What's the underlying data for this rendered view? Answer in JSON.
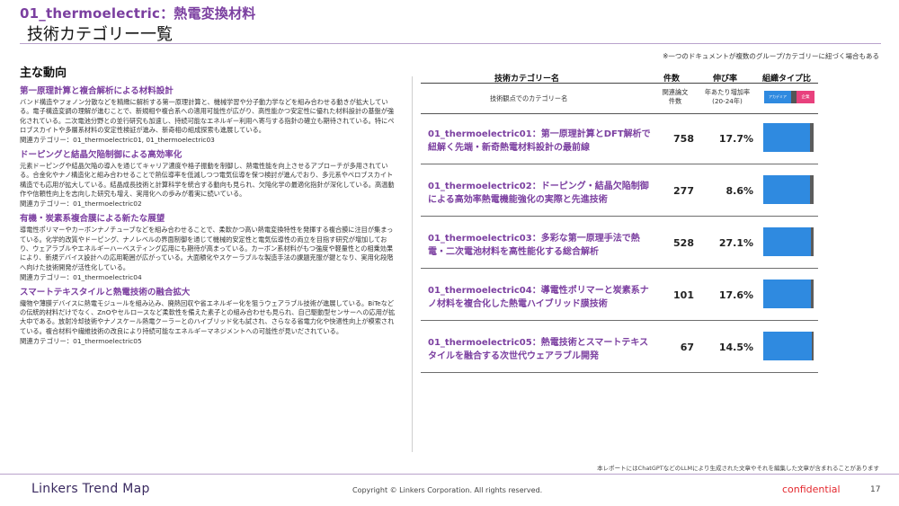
{
  "header": {
    "project_title": "01_thermoelectric：熱電変換材料",
    "page_title": "技術カテゴリー一覧"
  },
  "note_top": "※一つのドキュメントが複数のグループ/カテゴリーに紐づく場合もある",
  "trends": {
    "heading": "主な動向",
    "items": [
      {
        "title": "第一原理計算と複合解析による材料設計",
        "body": "バンド構造やフォノン分散などを精緻に解析する第一原理計算と、機械学習や分子動力学などを組み合わせる動きが拡大している。電子構造変調の理解が進むことで、新規相や複合系への適用可能性が広がり、高性能かつ安定性に優れた材料設計の基盤が強化されている。二次電池分野との並行研究も加速し、持続可能なエネルギー利用へ寄与する指針の確立も期待されている。特にペロブスカイトや多層系材料の安定性検証が進み、新奇相の組成探索も進展している。",
        "related": "関連カテゴリー：01_thermoelectric01, 01_thermoelectric03"
      },
      {
        "title": "ドーピングと結晶欠陥制御による高効率化",
        "body": "元素ドーピングや結晶欠陥の導入を通じてキャリア濃度や格子振動を制御し、熱電性能を向上させるアプローチが多用されている。合金化やナノ構造化と組み合わせることで熱伝導率を低減しつつ電気伝導を保つ検討が進んでおり、多元系やペロブスカイト構造でも応用が拡大している。結晶成長技術と計算科学を統合する動向も見られ、欠陥化学の最適化指針が深化している。高温動作や信頼性向上を志向した研究も増え、実用化への歩みが着実に続いている。",
        "related": "関連カテゴリー：01_thermoelectric02"
      },
      {
        "title": "有機・炭素系複合膜による新たな展望",
        "body": "導電性ポリマーやカーボンナノチューブなどを組み合わせることで、柔軟かつ高い熱電変換特性を発揮する複合膜に注目が集まっている。化学的改質やドーピング、ナノレベルの界面制御を通じて機械的安定性と電気伝導性の両立を目指す研究が増加しており、ウェアラブルやエネルギーハーベスティング応用にも期待が高まっている。カーボン系材料がもつ強度や軽量性との相乗効果により、新規デバイス設計への応用範囲が広がっている。大面積化やスケーラブルな製造手法の課題克服が鍵となり、実用化段階へ向けた技術開発が活性化している。",
        "related": "関連カテゴリー：01_thermoelectric04"
      },
      {
        "title": "スマートテキスタイルと熱電技術の融合拡大",
        "body": "織物や薄膜デバイスに熱電モジュールを組み込み、廃熱回収や省エネルギー化を狙うウェアラブル技術が進展している。BiTeなどの伝統的材料だけでなく、ZnOやセルロースなど柔軟性を備えた素子との組み合わせも見られ、自己駆動型センサーへの応用が拡大中である。放射冷却技術やナノスケール熱電クーラーとのハイブリッド化も試され、さらなる省電力化や快適性向上が模索されている。複合材料や繊維技術の改良により持続可能なエネルギーマネジメントへの可能性が見いだされている。",
        "related": "関連カテゴリー：01_thermoelectric05"
      }
    ]
  },
  "table": {
    "headers": {
      "name": "技術カテゴリー名",
      "count": "件数",
      "growth": "伸び率",
      "org": "組織タイプ比"
    },
    "subheaders": {
      "name": "技術観点でのカテゴリー名",
      "count_line1": "関連論文",
      "count_line2": "件数",
      "growth_line1": "年あたり増加率",
      "growth_line2": "(20-24年)"
    },
    "legend": {
      "academia": "アカデミア",
      "company": "企業"
    },
    "rows": [
      {
        "name": "01_thermoelectric01：第一原理計算とDFT解析で紐解く先端・新奇熱電材料設計の最前線",
        "count": "758",
        "growth": "17.7%",
        "org_share": [
          0.92,
          0.08,
          0.0
        ]
      },
      {
        "name": "01_thermoelectric02：ドーピング・結晶欠陥制御による高効率熱電機能強化の実際と先進技術",
        "count": "277",
        "growth": "8.6%",
        "org_share": [
          0.93,
          0.07,
          0.0
        ]
      },
      {
        "name": "01_thermoelectric03：多彩な第一原理手法で熱電・二次電池材料を高性能化する総合解析",
        "count": "528",
        "growth": "27.1%",
        "org_share": [
          0.95,
          0.05,
          0.0
        ]
      },
      {
        "name": "01_thermoelectric04：導電性ポリマーと炭素系ナノ材料を複合化した熱電ハイブリッド膜技術",
        "count": "101",
        "growth": "17.6%",
        "org_share": [
          0.94,
          0.06,
          0.0
        ]
      },
      {
        "name": "01_thermoelectric05：熱電技術とスマートテキスタイルを融合する次世代ウェアラブル開発",
        "count": "67",
        "growth": "14.5%",
        "org_share": [
          0.97,
          0.03,
          0.0
        ]
      }
    ]
  },
  "note_bottom": "本レポートにはChatGPTなどのLLMにより生成された文章やそれを編集した文章が含まれることがあります",
  "footer": {
    "brand": "Linkers Trend Map",
    "copyright": "Copyright © Linkers Corporation. All rights reserved.",
    "confidential": "confidential",
    "page_number": "17"
  },
  "colors": {
    "accent_purple": "#7b3fa0",
    "bar_academia": "#2f8ae0",
    "bar_mixed": "#5c5c5c",
    "bar_company": "#e8417d",
    "confidential_red": "#e4282e"
  }
}
